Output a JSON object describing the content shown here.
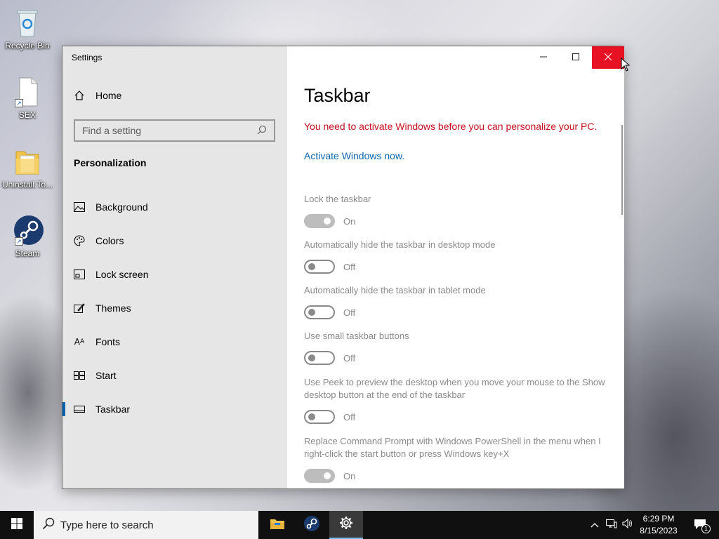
{
  "desktop": {
    "icons": [
      {
        "label": "Recycle Bin",
        "icon": "recycle-bin-icon"
      },
      {
        "label": "SEX",
        "icon": "document-icon"
      },
      {
        "label": "Uninstall.To...",
        "icon": "folder-icon"
      },
      {
        "label": "Steam",
        "icon": "steam-icon"
      }
    ]
  },
  "window": {
    "title": "Settings",
    "controls": {
      "minimize": "minimize-icon",
      "maximize": "maximize-icon",
      "close": "close-icon"
    }
  },
  "sidebar": {
    "home_label": "Home",
    "search_placeholder": "Find a setting",
    "section_title": "Personalization",
    "items": [
      {
        "label": "Background",
        "icon": "background-icon"
      },
      {
        "label": "Colors",
        "icon": "palette-icon"
      },
      {
        "label": "Lock screen",
        "icon": "lock-screen-icon"
      },
      {
        "label": "Themes",
        "icon": "themes-icon"
      },
      {
        "label": "Fonts",
        "icon": "fonts-icon"
      },
      {
        "label": "Start",
        "icon": "start-icon"
      },
      {
        "label": "Taskbar",
        "icon": "taskbar-icon",
        "selected": true
      }
    ]
  },
  "content": {
    "title": "Taskbar",
    "warning": "You need to activate Windows before you can personalize your PC.",
    "activate_link": "Activate Windows now.",
    "settings": [
      {
        "label": "Lock the taskbar",
        "state": "On"
      },
      {
        "label": "Automatically hide the taskbar in desktop mode",
        "state": "Off"
      },
      {
        "label": "Automatically hide the taskbar in tablet mode",
        "state": "Off"
      },
      {
        "label": "Use small taskbar buttons",
        "state": "Off"
      },
      {
        "label": "Use Peek to preview the desktop when you move your mouse to the Show desktop button at the end of the taskbar",
        "state": "Off"
      },
      {
        "label": "Replace Command Prompt with Windows PowerShell in the menu when I right-click the start button or press Windows key+X",
        "state": "On"
      }
    ]
  },
  "taskbar": {
    "search_placeholder": "Type here to search",
    "apps": [
      "file-explorer-icon",
      "steam-icon",
      "settings-icon"
    ],
    "clock_time": "6:29 PM",
    "clock_date": "8/15/2023",
    "notification_count": "1"
  },
  "colors": {
    "accent": "#0063b1",
    "close_button": "#e81123",
    "warning_text": "#c50f1f",
    "link": "#0a66b0"
  }
}
